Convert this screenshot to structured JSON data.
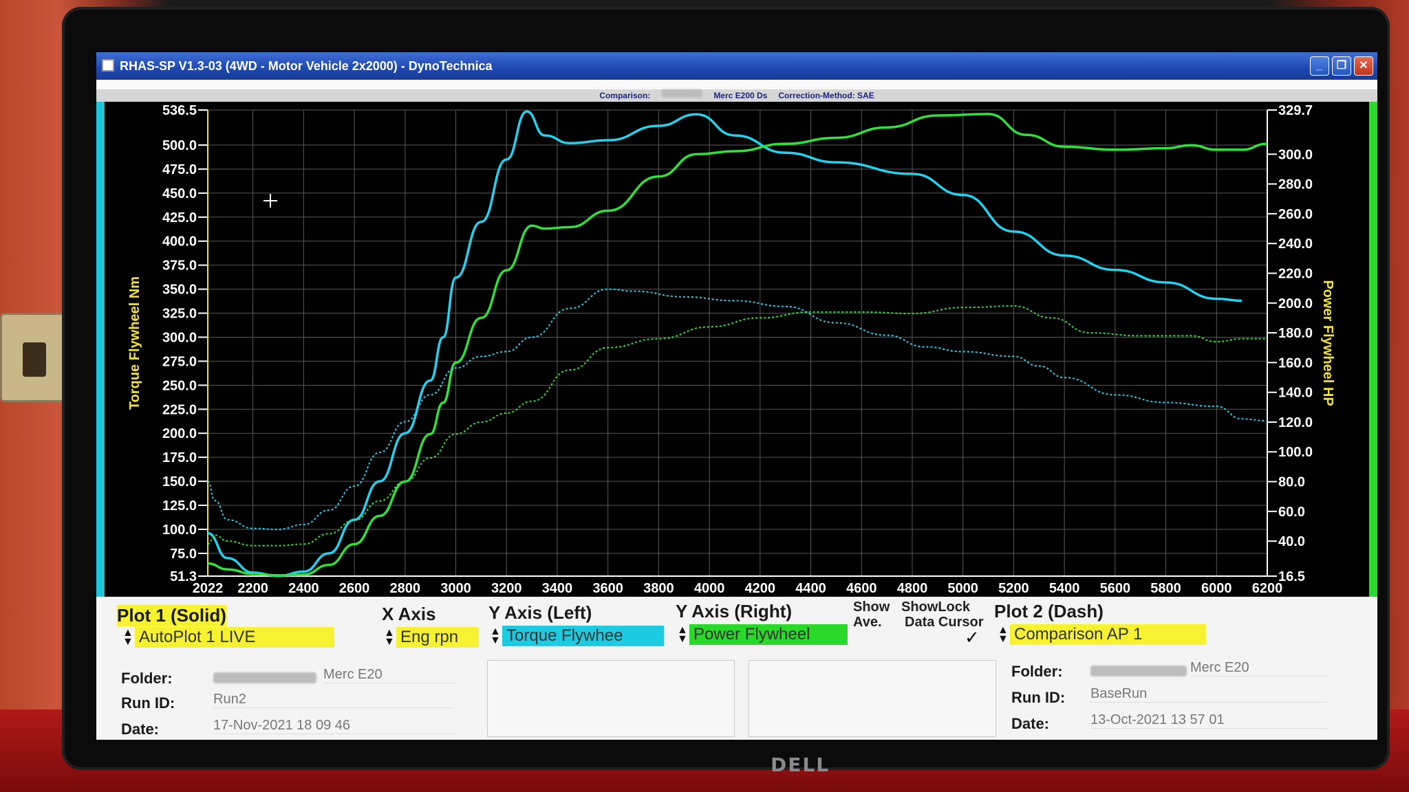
{
  "window": {
    "title": "RHAS-SP V1.3-03  (4WD - Motor Vehicle 2x2000) - DynoTechnica",
    "buttons": [
      "_",
      "❐",
      "✕"
    ]
  },
  "infobar": {
    "comparison_label": "Comparison:",
    "comparison_value": "Merc E200 Ds",
    "correction": "Correction-Method: SAE"
  },
  "chart_data": {
    "type": "line",
    "xlim": [
      2022,
      6200
    ],
    "x_ticks": [
      "2022",
      "2200",
      "2400",
      "2600",
      "2800",
      "3000",
      "3200",
      "3400",
      "3600",
      "3800",
      "4000",
      "4200",
      "4400",
      "4600",
      "4800",
      "5000",
      "5200",
      "5400",
      "5600",
      "5800",
      "6000",
      "6200"
    ],
    "ylim_left": [
      51.3,
      536.5
    ],
    "y_ticks_left": [
      "536.5",
      "500.0",
      "475.0",
      "450.0",
      "425.0",
      "400.0",
      "375.0",
      "350.0",
      "325.0",
      "300.0",
      "275.0",
      "250.0",
      "225.0",
      "200.0",
      "175.0",
      "150.0",
      "125.0",
      "100.0",
      "75.0",
      "51.3"
    ],
    "ylim_right": [
      16.5,
      329.7
    ],
    "y_ticks_right": [
      "329.7",
      "300.0",
      "280.0",
      "260.0",
      "240.0",
      "220.0",
      "200.0",
      "180.0",
      "160.0",
      "140.0",
      "120.0",
      "100.0",
      "80.0",
      "60.0",
      "40.0",
      "16.5"
    ],
    "ylabel_left": "Torque Flywheel Nm",
    "ylabel_right": "Power Flywheel HP",
    "grid": true,
    "series": [
      {
        "name": "Torque Flywheel",
        "color": "#22d3f0",
        "axis": "left",
        "style": "solid",
        "x": [
          2022,
          2100,
          2200,
          2300,
          2400,
          2500,
          2600,
          2700,
          2800,
          2900,
          2950,
          3000,
          3100,
          3200,
          3280,
          3350,
          3450,
          3600,
          3800,
          3950,
          4100,
          4300,
          4500,
          4800,
          5000,
          5200,
          5400,
          5600,
          5800,
          6000,
          6100
        ],
        "y": [
          96,
          70,
          55,
          51.5,
          56,
          75,
          110,
          150,
          200,
          255,
          300,
          362,
          420,
          485,
          535,
          510,
          502,
          505,
          520,
          532,
          510,
          492,
          482,
          470,
          448,
          410,
          385,
          370,
          357,
          340,
          338
        ]
      },
      {
        "name": "Power Flywheel",
        "color": "#2fe23a",
        "axis": "right",
        "style": "solid",
        "x": [
          2022,
          2100,
          2200,
          2300,
          2400,
          2500,
          2600,
          2700,
          2800,
          2900,
          2950,
          3000,
          3100,
          3200,
          3300,
          3350,
          3450,
          3600,
          3800,
          3950,
          4100,
          4300,
          4500,
          4700,
          4900,
          5100,
          5250,
          5400,
          5600,
          5800,
          5900,
          6000,
          6100,
          6200
        ],
        "y": [
          25,
          21,
          18,
          17,
          17.5,
          24,
          38,
          57,
          80,
          112,
          133,
          160,
          190,
          222,
          252,
          250,
          251,
          262,
          285,
          300,
          302,
          307,
          311,
          318,
          326,
          327,
          313,
          305,
          303,
          304,
          306,
          303,
          303,
          307
        ]
      },
      {
        "name": "Comparison Torque",
        "color": "#22d3f0",
        "axis": "left",
        "style": "dash",
        "x": [
          2022,
          2050,
          2100,
          2200,
          2300,
          2400,
          2500,
          2600,
          2700,
          2800,
          2900,
          3000,
          3100,
          3200,
          3300,
          3450,
          3600,
          3700,
          3900,
          4100,
          4300,
          4500,
          4700,
          4850,
          5000,
          5200,
          5300,
          5400,
          5600,
          5800,
          6000,
          6100,
          6200
        ],
        "y": [
          150,
          130,
          110,
          101,
          100,
          105,
          120,
          145,
          180,
          212,
          240,
          268,
          280,
          285,
          300,
          330,
          350,
          348,
          342,
          338,
          332,
          315,
          302,
          290,
          285,
          280,
          270,
          258,
          240,
          232,
          228,
          215,
          213
        ]
      },
      {
        "name": "Comparison Power",
        "color": "#2fe23a",
        "axis": "right",
        "style": "dash",
        "x": [
          2022,
          2050,
          2100,
          2200,
          2300,
          2400,
          2500,
          2600,
          2700,
          2800,
          2900,
          3000,
          3100,
          3200,
          3300,
          3450,
          3600,
          3800,
          4000,
          4200,
          4400,
          4600,
          4800,
          5000,
          5200,
          5350,
          5500,
          5700,
          5900,
          6000,
          6100,
          6200
        ],
        "y": [
          38,
          44,
          40,
          37,
          37,
          38,
          45,
          54,
          67,
          80,
          96,
          112,
          120,
          126,
          134,
          155,
          170,
          176,
          184,
          190,
          194,
          194,
          193,
          197,
          198,
          190,
          180,
          178,
          178,
          174,
          176,
          176
        ]
      }
    ]
  },
  "panel": {
    "plot1_title": "Plot 1 (Solid)",
    "plot1_select": "AutoPlot 1 LIVE",
    "x_axis_title": "X Axis",
    "x_axis_select": "Eng rpn",
    "y_left_title": "Y Axis (Left)",
    "y_left_select": "Torque Flywhee",
    "y_right_title": "Y Axis (Right)",
    "y_right_select": "Power Flywheel",
    "show_title": "Show",
    "ave_title": "Ave.",
    "showlock_title": "ShowLock",
    "datacursor_title": "Data Cursor",
    "plot2_title": "Plot 2 (Dash)",
    "plot2_select": "Comparison AP 1",
    "folder_label": "Folder:",
    "runid_label": "Run ID:",
    "date_label": "Date:",
    "run1": {
      "folder": "Merc E20",
      "run_id": "Run2",
      "date": "17-Nov-2021   18 09 46"
    },
    "run2": {
      "folder": "Merc E20",
      "run_id": "BaseRun",
      "date": "13-Oct-2021   13 57 01"
    },
    "check_mark": "✓"
  },
  "bezel": {
    "brand": "DELL"
  }
}
